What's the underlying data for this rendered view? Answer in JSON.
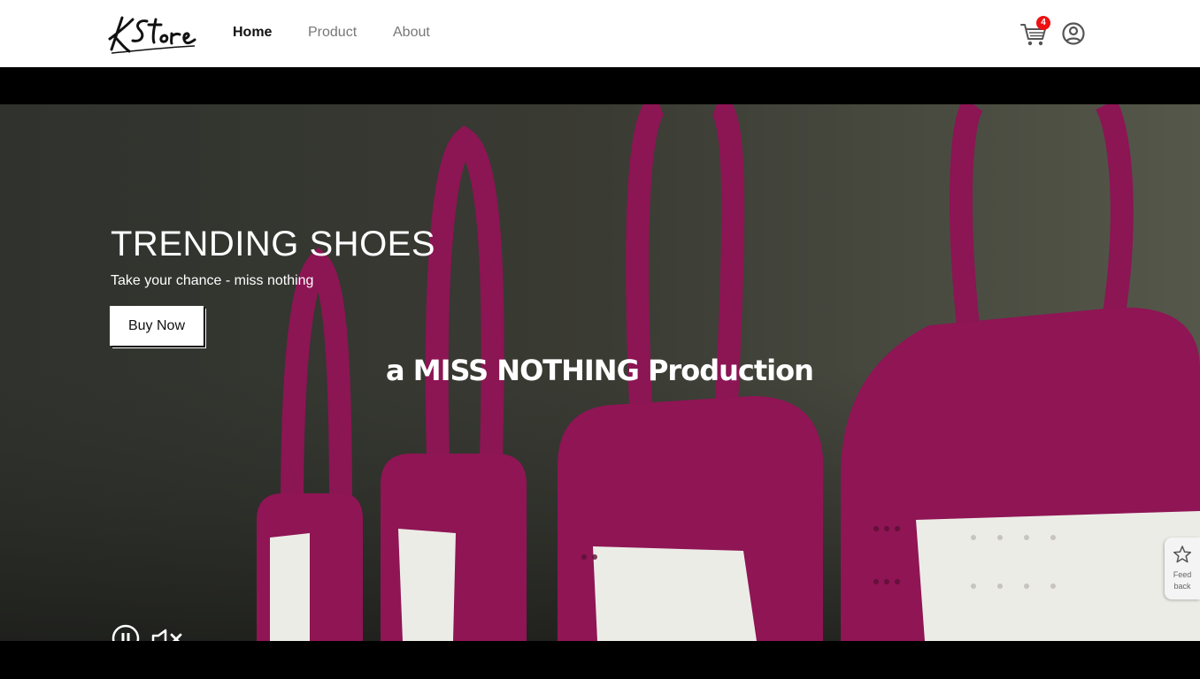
{
  "header": {
    "logo_text": "KStore",
    "nav": [
      {
        "label": "Home",
        "active": true
      },
      {
        "label": "Product",
        "active": false
      },
      {
        "label": "About",
        "active": false
      }
    ],
    "cart_count": "4",
    "cart_icon": "cart-icon",
    "user_icon": "user-circle-icon"
  },
  "hero": {
    "title": "TRENDING SHOES",
    "subtitle": "Take your chance - miss nothing",
    "cta_label": "Buy Now",
    "video_caption": "a MISS NOTHING Production",
    "controls": {
      "pause_icon": "pause-icon",
      "mute_icon": "mute-icon"
    }
  },
  "feedback": {
    "label": "Feed back",
    "icon": "star-icon"
  },
  "colors": {
    "header_bg": "#ffffff",
    "letterbox": "#000000",
    "badge": "#e11111",
    "tag_magenta": "#8f1555"
  }
}
